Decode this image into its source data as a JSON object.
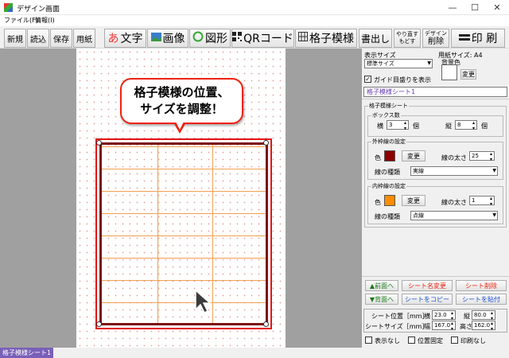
{
  "window": {
    "title": "デザイン画面",
    "minimize": "—",
    "maximize": "☐",
    "close": "✕"
  },
  "menu": [
    "ファイル(F)",
    "情報(I)"
  ],
  "toolbar": {
    "new": "新規",
    "load": "読込",
    "save": "保存",
    "paper": "用紙",
    "text_icon": "あ",
    "text": "文字",
    "image": "画像",
    "shape": "図形",
    "qr": "QRコード",
    "grid": "格子模様",
    "extract": "書出し",
    "undo_line1": "やり直す",
    "undo_line2": "もどす",
    "delete_line1": "デザイン",
    "delete_line2": "削除",
    "print": "印 刷"
  },
  "callout": {
    "line1": "格子模様の位置、",
    "line2": "サイズを調整！"
  },
  "status": {
    "tab": "格子模様シート1"
  },
  "panel": {
    "display_size_label": "表示サイズ",
    "display_size_value": "標準サイズ",
    "paper_size": "用紙サイズ: A4",
    "bg_color_label": "背景色",
    "change": "変更",
    "guide_label": "ガイド目盛りを表示",
    "guide_checked": "✓",
    "sheet_name": "格子模様シート1",
    "grid_sheet_group": "格子模様シート",
    "box_count_group": "ボックス数",
    "horizontal": "横",
    "vertical": "縦",
    "h_count": "3",
    "v_count": "8",
    "unit_count": "個",
    "outer_group": "外枠線の設定",
    "color": "色",
    "outer_color": "#8b0000",
    "line_width": "線の太さ",
    "outer_width": "25",
    "line_type": "線の種類",
    "outer_type": "実線",
    "inner_group": "内枠線の設定",
    "inner_color": "#ff8c00",
    "inner_width": "1",
    "inner_type": "点線",
    "front": "▲前面へ",
    "back": "▼背面へ",
    "rename": "シート名変更",
    "delete_sheet": "シート削除",
    "copy_sheet": "シートをコピー",
    "paste_sheet": "シートを貼付",
    "sheet_pos_label": "シート位置［mm］",
    "sheet_size_label": "シートサイズ［mm］",
    "pos_x_label": "横",
    "pos_x": "23.0",
    "pos_y_label": "縦",
    "pos_y": "80.0",
    "width_label": "幅",
    "width": "167.0",
    "height_label": "高さ",
    "height": "162.0",
    "hide": "表示なし",
    "fix_pos": "位置固定",
    "no_print": "印刷なし"
  }
}
